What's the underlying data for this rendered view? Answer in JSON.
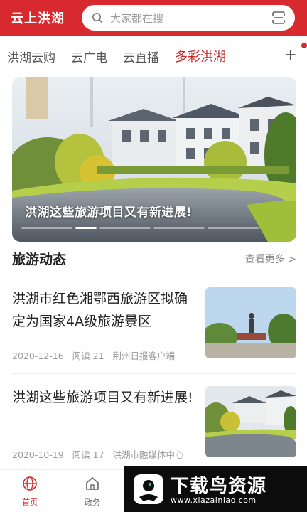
{
  "header": {
    "logo": "云上洪湖",
    "search_placeholder": "大家都在搜"
  },
  "tabs": [
    {
      "label": "洪湖云购",
      "active": false
    },
    {
      "label": "云广电",
      "active": false
    },
    {
      "label": "云直播",
      "active": false
    },
    {
      "label": "多彩洪湖",
      "active": true
    }
  ],
  "tabs_more": "+",
  "banner": {
    "title": "洪湖这些旅游项目又有新进展!",
    "slide_count": 6,
    "active_slide": 2
  },
  "section": {
    "title": "旅游动态",
    "more": "查看更多 >"
  },
  "news": [
    {
      "title": "洪湖市红色湘鄂西旅游区拟确定为国家4A级旅游景区",
      "date": "2020-12-16",
      "reads": "阅读 21",
      "source": "荆州日报客户端"
    },
    {
      "title": "洪湖这些旅游项目又有新进展!",
      "date": "2020-10-19",
      "reads": "阅读 17",
      "source": "洪湖市融媒体中心"
    }
  ],
  "bottom_nav": [
    {
      "label": "首页",
      "icon": "globe-icon",
      "active": true
    },
    {
      "label": "政务",
      "icon": "home-icon",
      "active": false
    }
  ],
  "watermark": {
    "text": "下载鸟资源",
    "url": "www.xiazainiao.com"
  },
  "colors": {
    "brand_red": "#d8292f",
    "active_tab": "#c8262b",
    "muted": "#9a9a9a"
  }
}
